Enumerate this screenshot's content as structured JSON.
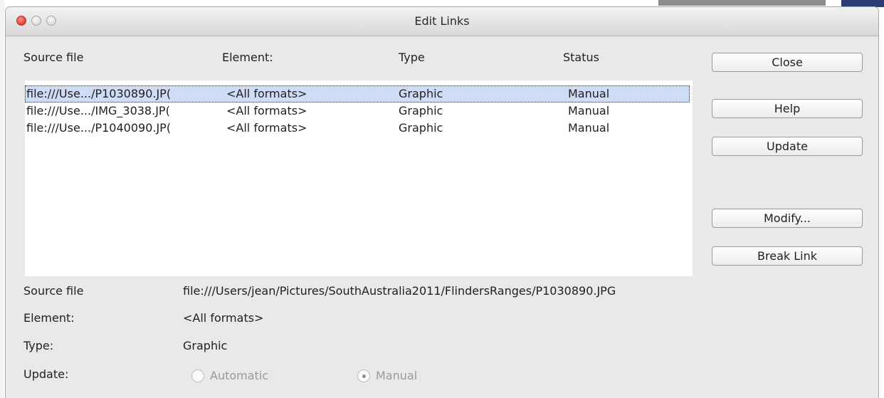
{
  "window": {
    "title": "Edit Links"
  },
  "list": {
    "headers": {
      "source": "Source file",
      "element": "Element:",
      "type": "Type",
      "status": "Status"
    },
    "rows": [
      {
        "source": "file:///Use.../P1030890.JP(",
        "element": "<All formats>",
        "type": "Graphic",
        "status": "Manual"
      },
      {
        "source": "file:///Use.../IMG_3038.JP(",
        "element": "<All formats>",
        "type": "Graphic",
        "status": "Manual"
      },
      {
        "source": "file:///Use.../P1040090.JP(",
        "element": "<All formats>",
        "type": "Graphic",
        "status": "Manual"
      }
    ]
  },
  "buttons": {
    "close": "Close",
    "help": "Help",
    "update": "Update",
    "modify": "Modify...",
    "break_link": "Break Link"
  },
  "details": {
    "source_label": "Source file",
    "source_value": "file:///Users/jean/Pictures/SouthAustralia2011/FlindersRanges/P1030890.JPG",
    "element_label": "Element:",
    "element_value": "<All formats>",
    "type_label": "Type:",
    "type_value": "Graphic",
    "update_label": "Update:",
    "automatic": "Automatic",
    "manual": "Manual"
  },
  "colors": {
    "selection": "#cfdcf5",
    "close_button": "#e1443b"
  }
}
